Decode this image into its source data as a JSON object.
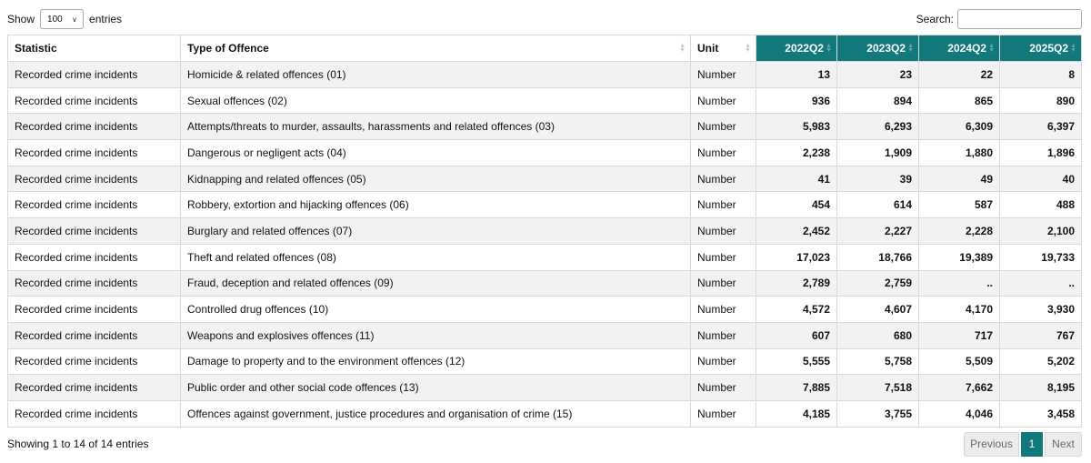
{
  "controls": {
    "show_label": "Show",
    "page_size": "100",
    "entries_label": "entries",
    "search_label": "Search:",
    "search_value": ""
  },
  "table": {
    "headers": [
      "Statistic",
      "Type of Offence",
      "Unit",
      "2022Q2",
      "2023Q2",
      "2024Q2",
      "2025Q2"
    ],
    "rows": [
      [
        "Recorded crime incidents",
        "Homicide & related offences (01)",
        "Number",
        "13",
        "23",
        "22",
        "8"
      ],
      [
        "Recorded crime incidents",
        "Sexual offences (02)",
        "Number",
        "936",
        "894",
        "865",
        "890"
      ],
      [
        "Recorded crime incidents",
        "Attempts/threats to murder, assaults, harassments and related offences (03)",
        "Number",
        "5,983",
        "6,293",
        "6,309",
        "6,397"
      ],
      [
        "Recorded crime incidents",
        "Dangerous or negligent acts (04)",
        "Number",
        "2,238",
        "1,909",
        "1,880",
        "1,896"
      ],
      [
        "Recorded crime incidents",
        "Kidnapping and related offences (05)",
        "Number",
        "41",
        "39",
        "49",
        "40"
      ],
      [
        "Recorded crime incidents",
        "Robbery, extortion and hijacking offences (06)",
        "Number",
        "454",
        "614",
        "587",
        "488"
      ],
      [
        "Recorded crime incidents",
        "Burglary and related offences (07)",
        "Number",
        "2,452",
        "2,227",
        "2,228",
        "2,100"
      ],
      [
        "Recorded crime incidents",
        "Theft and related offences (08)",
        "Number",
        "17,023",
        "18,766",
        "19,389",
        "19,733"
      ],
      [
        "Recorded crime incidents",
        "Fraud, deception and related offences (09)",
        "Number",
        "2,789",
        "2,759",
        "..",
        ".."
      ],
      [
        "Recorded crime incidents",
        "Controlled drug offences (10)",
        "Number",
        "4,572",
        "4,607",
        "4,170",
        "3,930"
      ],
      [
        "Recorded crime incidents",
        "Weapons and explosives offences (11)",
        "Number",
        "607",
        "680",
        "717",
        "767"
      ],
      [
        "Recorded crime incidents",
        "Damage to property and to the environment offences (12)",
        "Number",
        "5,555",
        "5,758",
        "5,509",
        "5,202"
      ],
      [
        "Recorded crime incidents",
        "Public order and other social code offences (13)",
        "Number",
        "7,885",
        "7,518",
        "7,662",
        "8,195"
      ],
      [
        "Recorded crime incidents",
        "Offences against government, justice procedures and organisation of crime (15)",
        "Number",
        "4,185",
        "3,755",
        "4,046",
        "3,458"
      ]
    ]
  },
  "footer": {
    "info": "Showing 1 to 14 of 14 entries",
    "prev_label": "Previous",
    "current_page": "1",
    "next_label": "Next"
  },
  "colors": {
    "accent": "#11787c"
  }
}
